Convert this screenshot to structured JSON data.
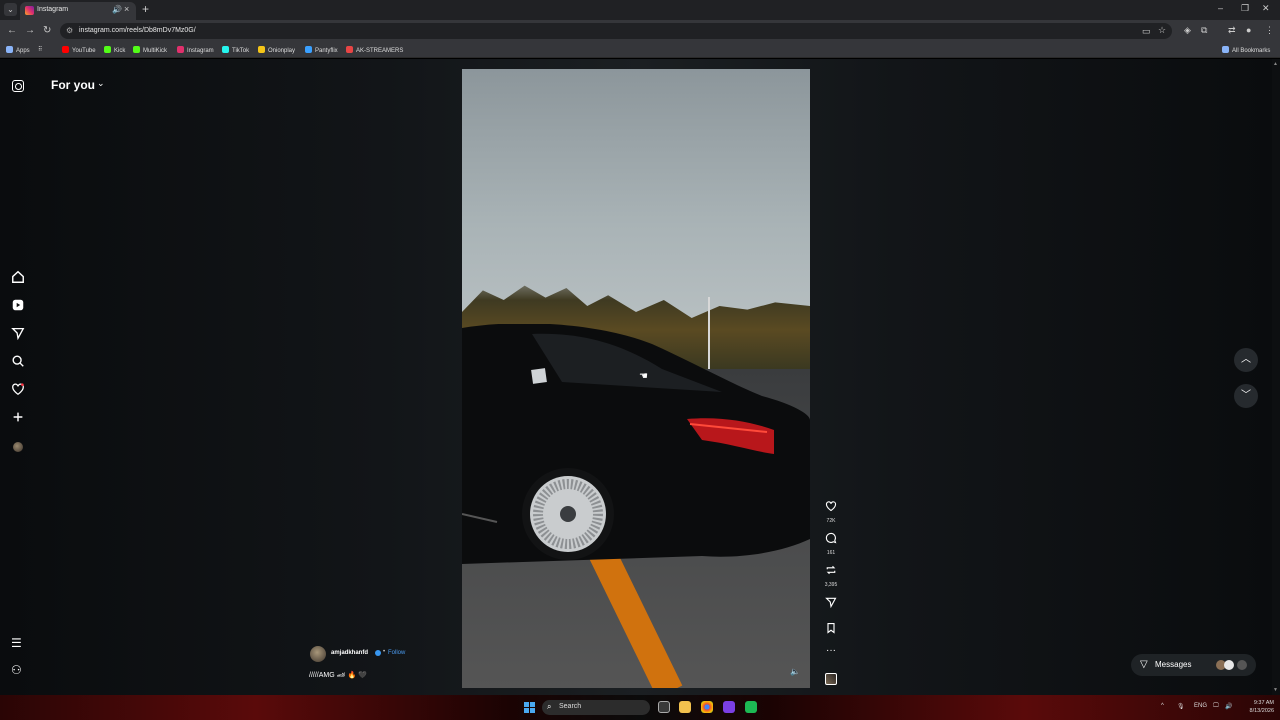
{
  "browser": {
    "tab": {
      "title": "Instagram"
    },
    "url": "instagram.com/reels/Db8mDv7Mz0G/",
    "bookmarks": [
      {
        "label": "Apps",
        "color": "#8ab4f8"
      },
      {
        "label": "YouTube",
        "color": "#ff0000"
      },
      {
        "label": "Kick",
        "color": "#53fc18"
      },
      {
        "label": "MultiKick",
        "color": "#53fc18"
      },
      {
        "label": "Instagram",
        "color": "#e1306c"
      },
      {
        "label": "TikTok",
        "color": "#25f4ee"
      },
      {
        "label": "Onionplay",
        "color": "#f5c518"
      },
      {
        "label": "Pantyflix",
        "color": "#3aa0ff"
      },
      {
        "label": "AK-STREAMERS",
        "color": "#e84545"
      }
    ],
    "all_bookmarks": "All Bookmarks"
  },
  "header": {
    "feed_label": "For you"
  },
  "sidebar": {
    "items": [
      {
        "name": "home-icon"
      },
      {
        "name": "reels-icon"
      },
      {
        "name": "direct-icon"
      },
      {
        "name": "search-icon"
      },
      {
        "name": "heart-icon"
      },
      {
        "name": "create-icon"
      },
      {
        "name": "profile-avatar"
      }
    ]
  },
  "reel": {
    "author": "amjadkhanfd",
    "follow": "Follow",
    "separator": "•",
    "caption": "/////AMG 🏎 🔥 🖤",
    "likes": "72K",
    "comments": "161",
    "reposts": "3,395"
  },
  "messages": {
    "label": "Messages"
  },
  "taskbar": {
    "search": "Search",
    "lang": "ENG",
    "time": "9:37 AM",
    "date": "8/13/2026"
  }
}
